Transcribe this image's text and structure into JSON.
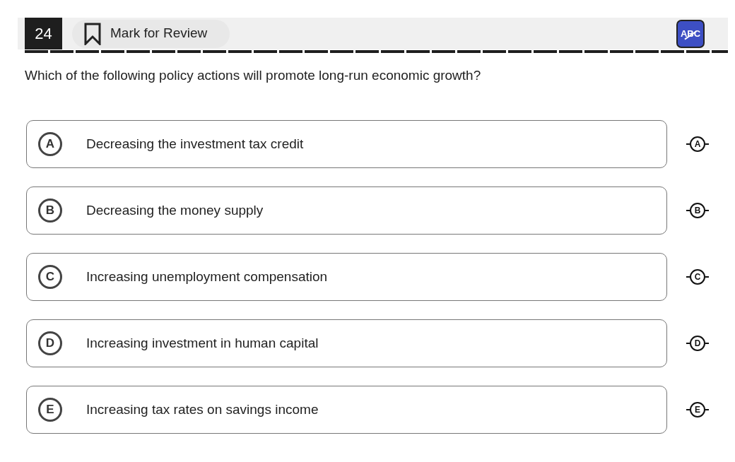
{
  "header": {
    "question_number": "24",
    "mark_for_review": {
      "label": "Mark for Review",
      "marked": false
    },
    "eliminator": {
      "label": "ABC",
      "on": true
    }
  },
  "question": "Which of the following policy actions will promote long-run economic growth?",
  "options": [
    {
      "letter": "A",
      "text": "Decreasing the investment tax credit",
      "selected": false,
      "eliminate_letter": "A"
    },
    {
      "letter": "B",
      "text": "Decreasing the money supply",
      "selected": false,
      "eliminate_letter": "B"
    },
    {
      "letter": "C",
      "text": "Increasing unemployment compensation",
      "selected": false,
      "eliminate_letter": "C"
    },
    {
      "letter": "D",
      "text": "Increasing investment in human capital",
      "selected": false,
      "eliminate_letter": "D"
    },
    {
      "letter": "E",
      "text": "Increasing tax rates on savings income",
      "selected": false,
      "eliminate_letter": "E"
    }
  ]
}
